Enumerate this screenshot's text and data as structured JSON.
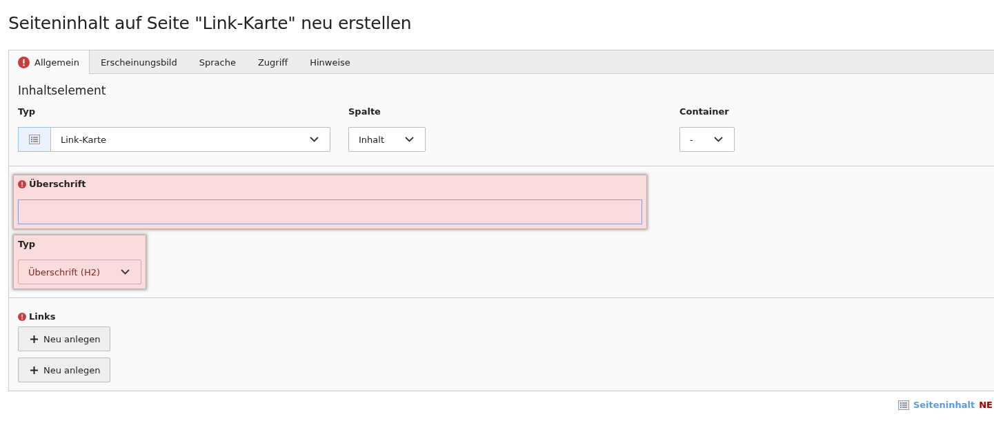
{
  "page_title": "Seiteninhalt auf Seite \"Link-Karte\" neu erstellen",
  "tabs": [
    {
      "label": "Allgemein",
      "selected": true,
      "error": true
    },
    {
      "label": "Erscheinungsbild",
      "selected": false,
      "error": false
    },
    {
      "label": "Sprache",
      "selected": false,
      "error": false
    },
    {
      "label": "Zugriff",
      "selected": false,
      "error": false
    },
    {
      "label": "Hinweise",
      "selected": false,
      "error": false
    }
  ],
  "general": {
    "heading": "Inhaltselement",
    "fields": [
      {
        "label": "Typ",
        "value": "Link-Karte",
        "kind": "icon-select"
      },
      {
        "label": "Spalte",
        "value": "Inhalt",
        "kind": "select"
      },
      {
        "label": "Container",
        "value": "-",
        "kind": "select"
      }
    ]
  },
  "header_fields": [
    {
      "label": "Überschrift",
      "kind": "text",
      "error": true,
      "highlighted": true
    },
    {
      "label": "Typ",
      "kind": "select",
      "value": "Überschrift (H2)",
      "error": false,
      "highlighted": true
    }
  ],
  "links": {
    "label": "Links",
    "error": true,
    "buttons": [
      "Neu anlegen",
      "Neu anlegen"
    ]
  },
  "footer": {
    "label": "Seiteninhalt",
    "status": "NE"
  }
}
